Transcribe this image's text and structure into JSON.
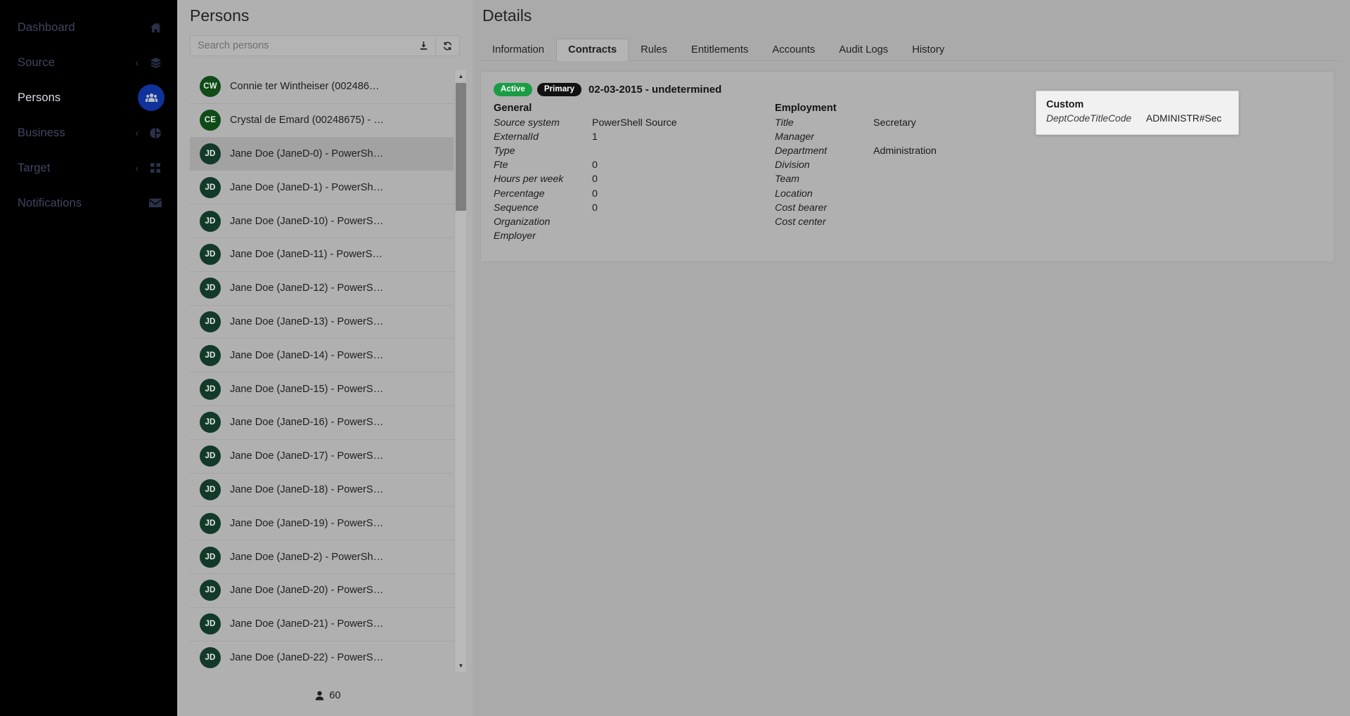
{
  "sidebar": {
    "items": [
      {
        "label": "Dashboard",
        "icon": "home-icon",
        "caret": false,
        "active": false
      },
      {
        "label": "Source",
        "icon": "layers-icon",
        "caret": true,
        "active": false
      },
      {
        "label": "Persons",
        "icon": "people-icon",
        "caret": false,
        "active": true
      },
      {
        "label": "Business",
        "icon": "pie-chart-icon",
        "caret": true,
        "active": false
      },
      {
        "label": "Target",
        "icon": "grid-icon",
        "caret": true,
        "active": false
      },
      {
        "label": "Notifications",
        "icon": "envelope-icon",
        "caret": false,
        "active": false
      }
    ],
    "caret_glyph": "‹"
  },
  "persons_panel": {
    "title": "Persons",
    "search": {
      "value": "",
      "placeholder": "Search persons"
    },
    "buttons": [
      {
        "name": "download-button",
        "icon": "download-icon"
      },
      {
        "name": "refresh-button",
        "icon": "refresh-icon"
      }
    ],
    "count": "60",
    "count_icon": "person-icon",
    "rows": [
      {
        "initials": "CW",
        "label": "Connie ter Wintheiser (002486…",
        "avatar_class": "cw",
        "selected": false
      },
      {
        "initials": "CE",
        "label": "Crystal de Emard (00248675) - …",
        "avatar_class": "ce",
        "selected": false
      },
      {
        "initials": "JD",
        "label": "Jane Doe (JaneD-0) - PowerSh…",
        "avatar_class": "jd",
        "selected": true
      },
      {
        "initials": "JD",
        "label": "Jane Doe (JaneD-1) - PowerSh…",
        "avatar_class": "jd",
        "selected": false
      },
      {
        "initials": "JD",
        "label": "Jane Doe (JaneD-10) - PowerS…",
        "avatar_class": "jd",
        "selected": false
      },
      {
        "initials": "JD",
        "label": "Jane Doe (JaneD-11) - PowerS…",
        "avatar_class": "jd",
        "selected": false
      },
      {
        "initials": "JD",
        "label": "Jane Doe (JaneD-12) - PowerS…",
        "avatar_class": "jd",
        "selected": false
      },
      {
        "initials": "JD",
        "label": "Jane Doe (JaneD-13) - PowerS…",
        "avatar_class": "jd",
        "selected": false
      },
      {
        "initials": "JD",
        "label": "Jane Doe (JaneD-14) - PowerS…",
        "avatar_class": "jd",
        "selected": false
      },
      {
        "initials": "JD",
        "label": "Jane Doe (JaneD-15) - PowerS…",
        "avatar_class": "jd",
        "selected": false
      },
      {
        "initials": "JD",
        "label": "Jane Doe (JaneD-16) - PowerS…",
        "avatar_class": "jd",
        "selected": false
      },
      {
        "initials": "JD",
        "label": "Jane Doe (JaneD-17) - PowerS…",
        "avatar_class": "jd",
        "selected": false
      },
      {
        "initials": "JD",
        "label": "Jane Doe (JaneD-18) - PowerS…",
        "avatar_class": "jd",
        "selected": false
      },
      {
        "initials": "JD",
        "label": "Jane Doe (JaneD-19) - PowerS…",
        "avatar_class": "jd",
        "selected": false
      },
      {
        "initials": "JD",
        "label": "Jane Doe (JaneD-2) - PowerSh…",
        "avatar_class": "jd",
        "selected": false
      },
      {
        "initials": "JD",
        "label": "Jane Doe (JaneD-20) - PowerS…",
        "avatar_class": "jd",
        "selected": false
      },
      {
        "initials": "JD",
        "label": "Jane Doe (JaneD-21) - PowerS…",
        "avatar_class": "jd",
        "selected": false
      },
      {
        "initials": "JD",
        "label": "Jane Doe (JaneD-22) - PowerS…",
        "avatar_class": "jd",
        "selected": false
      }
    ]
  },
  "details": {
    "title": "Details",
    "tabs": [
      {
        "label": "Information",
        "active": false
      },
      {
        "label": "Contracts",
        "active": true
      },
      {
        "label": "Rules",
        "active": false
      },
      {
        "label": "Entitlements",
        "active": false
      },
      {
        "label": "Accounts",
        "active": false
      },
      {
        "label": "Audit Logs",
        "active": false
      },
      {
        "label": "History",
        "active": false
      }
    ],
    "contract": {
      "badges": [
        {
          "label": "Active",
          "type": "active"
        },
        {
          "label": "Primary",
          "type": "primary"
        }
      ],
      "period": "02-03-2015 - undetermined",
      "general": {
        "heading": "General",
        "fields": [
          {
            "key": "Source system",
            "value": "PowerShell Source"
          },
          {
            "key": "ExternalId",
            "value": "1"
          },
          {
            "key": "Type",
            "value": ""
          },
          {
            "key": "Fte",
            "value": "0"
          },
          {
            "key": "Hours per week",
            "value": "0"
          },
          {
            "key": "Percentage",
            "value": "0"
          },
          {
            "key": "Sequence",
            "value": "0"
          },
          {
            "key": "Organization",
            "value": ""
          },
          {
            "key": "Employer",
            "value": ""
          }
        ]
      },
      "employment": {
        "heading": "Employment",
        "fields": [
          {
            "key": "Title",
            "value": "Secretary"
          },
          {
            "key": "Manager",
            "value": ""
          },
          {
            "key": "Department",
            "value": "Administration"
          },
          {
            "key": "Division",
            "value": ""
          },
          {
            "key": "Team",
            "value": ""
          },
          {
            "key": "Location",
            "value": ""
          },
          {
            "key": "Cost bearer",
            "value": ""
          },
          {
            "key": "Cost center",
            "value": ""
          }
        ]
      }
    }
  },
  "popup": {
    "heading": "Custom",
    "rows": [
      {
        "key": "DeptCodeTitleCode",
        "value": "ADMINISTR#Sec"
      }
    ]
  },
  "colors": {
    "accent_blue": "#10329b",
    "badge_active_green": "#1a9c44",
    "badge_primary_black": "#121212",
    "avatar_green_dark": "#133a29",
    "avatar_green": "#0f4b17",
    "overlay_gray": "#aaaaab"
  }
}
